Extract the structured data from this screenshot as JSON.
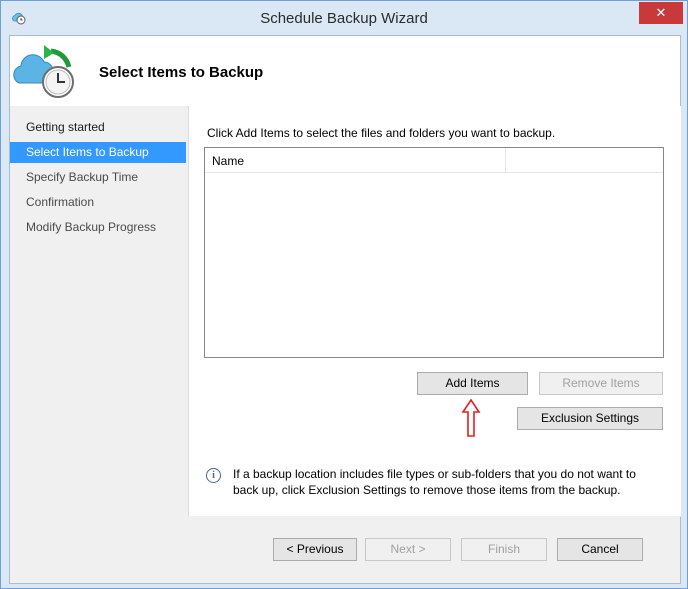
{
  "window": {
    "title": "Schedule Backup Wizard",
    "close_glyph": "✕"
  },
  "header": {
    "title": "Select Items to Backup",
    "icon": "cloud-clock-backup-icon"
  },
  "steps": [
    {
      "label": "Getting started"
    },
    {
      "label": "Select Items to Backup"
    },
    {
      "label": "Specify Backup Time"
    },
    {
      "label": "Confirmation"
    },
    {
      "label": "Modify Backup Progress"
    }
  ],
  "content": {
    "instruction": "Click Add Items to select the files and folders you want to backup.",
    "list_column": "Name",
    "add_items": "Add Items",
    "remove_items": "Remove Items",
    "exclusion_settings": "Exclusion Settings",
    "info_text": "If a backup location includes file types or sub-folders that you do not want to back up, click Exclusion Settings to remove those items from the backup."
  },
  "footer": {
    "previous": "< Previous",
    "next": "Next >",
    "finish": "Finish",
    "cancel": "Cancel"
  },
  "colors": {
    "selected_step": "#3399ff",
    "annotation_arrow": "#e02020",
    "close_button": "#c7393a"
  }
}
